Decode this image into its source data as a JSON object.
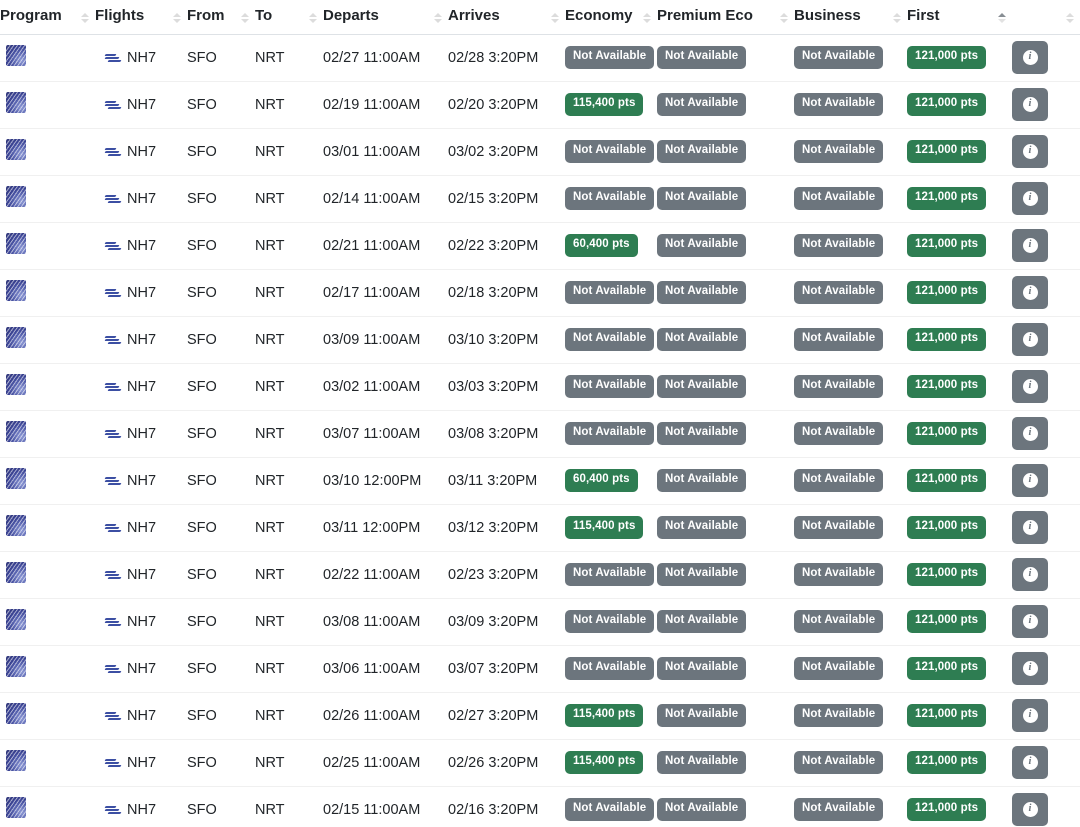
{
  "table": {
    "columns": [
      {
        "key": "program",
        "label": "Program",
        "sortable": true,
        "sort_state": "none"
      },
      {
        "key": "flights",
        "label": "Flights",
        "sortable": true,
        "sort_state": "none"
      },
      {
        "key": "from",
        "label": "From",
        "sortable": true,
        "sort_state": "none"
      },
      {
        "key": "to",
        "label": "To",
        "sortable": true,
        "sort_state": "none"
      },
      {
        "key": "departs",
        "label": "Departs",
        "sortable": true,
        "sort_state": "none"
      },
      {
        "key": "arrives",
        "label": "Arrives",
        "sortable": true,
        "sort_state": "none"
      },
      {
        "key": "economy",
        "label": "Economy",
        "sortable": true,
        "sort_state": "none"
      },
      {
        "key": "premium",
        "label": "Premium Eco",
        "sortable": true,
        "sort_state": "none"
      },
      {
        "key": "business",
        "label": "Business",
        "sortable": true,
        "sort_state": "none"
      },
      {
        "key": "first",
        "label": "First",
        "sortable": true,
        "sort_state": "asc"
      },
      {
        "key": "info",
        "label": "",
        "sortable": true,
        "sort_state": "none"
      }
    ],
    "not_available_label": "Not Available",
    "info_icon": "info-icon",
    "program_icon": "ana-program-logo-icon",
    "airline_icon": "ana-airline-logo-icon",
    "colors": {
      "badge_available": "#2e7d52",
      "badge_unavailable": "#6c757d",
      "text": "#212529",
      "header_divider": "#dee2e6",
      "program_logo": "#3b4495"
    },
    "rows": [
      {
        "flight": "NH7",
        "from": "SFO",
        "to": "NRT",
        "departs": "02/27 11:00AM",
        "arrives": "02/28 3:20PM",
        "economy": "Not Available",
        "economy_available": false,
        "premium": "Not Available",
        "premium_available": false,
        "business": "Not Available",
        "business_available": false,
        "first": "121,000 pts",
        "first_available": true
      },
      {
        "flight": "NH7",
        "from": "SFO",
        "to": "NRT",
        "departs": "02/19 11:00AM",
        "arrives": "02/20 3:20PM",
        "economy": "115,400 pts",
        "economy_available": true,
        "premium": "Not Available",
        "premium_available": false,
        "business": "Not Available",
        "business_available": false,
        "first": "121,000 pts",
        "first_available": true
      },
      {
        "flight": "NH7",
        "from": "SFO",
        "to": "NRT",
        "departs": "03/01 11:00AM",
        "arrives": "03/02 3:20PM",
        "economy": "Not Available",
        "economy_available": false,
        "premium": "Not Available",
        "premium_available": false,
        "business": "Not Available",
        "business_available": false,
        "first": "121,000 pts",
        "first_available": true
      },
      {
        "flight": "NH7",
        "from": "SFO",
        "to": "NRT",
        "departs": "02/14 11:00AM",
        "arrives": "02/15 3:20PM",
        "economy": "Not Available",
        "economy_available": false,
        "premium": "Not Available",
        "premium_available": false,
        "business": "Not Available",
        "business_available": false,
        "first": "121,000 pts",
        "first_available": true
      },
      {
        "flight": "NH7",
        "from": "SFO",
        "to": "NRT",
        "departs": "02/21 11:00AM",
        "arrives": "02/22 3:20PM",
        "economy": "60,400 pts",
        "economy_available": true,
        "premium": "Not Available",
        "premium_available": false,
        "business": "Not Available",
        "business_available": false,
        "first": "121,000 pts",
        "first_available": true
      },
      {
        "flight": "NH7",
        "from": "SFO",
        "to": "NRT",
        "departs": "02/17 11:00AM",
        "arrives": "02/18 3:20PM",
        "economy": "Not Available",
        "economy_available": false,
        "premium": "Not Available",
        "premium_available": false,
        "business": "Not Available",
        "business_available": false,
        "first": "121,000 pts",
        "first_available": true
      },
      {
        "flight": "NH7",
        "from": "SFO",
        "to": "NRT",
        "departs": "03/09 11:00AM",
        "arrives": "03/10 3:20PM",
        "economy": "Not Available",
        "economy_available": false,
        "premium": "Not Available",
        "premium_available": false,
        "business": "Not Available",
        "business_available": false,
        "first": "121,000 pts",
        "first_available": true
      },
      {
        "flight": "NH7",
        "from": "SFO",
        "to": "NRT",
        "departs": "03/02 11:00AM",
        "arrives": "03/03 3:20PM",
        "economy": "Not Available",
        "economy_available": false,
        "premium": "Not Available",
        "premium_available": false,
        "business": "Not Available",
        "business_available": false,
        "first": "121,000 pts",
        "first_available": true
      },
      {
        "flight": "NH7",
        "from": "SFO",
        "to": "NRT",
        "departs": "03/07 11:00AM",
        "arrives": "03/08 3:20PM",
        "economy": "Not Available",
        "economy_available": false,
        "premium": "Not Available",
        "premium_available": false,
        "business": "Not Available",
        "business_available": false,
        "first": "121,000 pts",
        "first_available": true
      },
      {
        "flight": "NH7",
        "from": "SFO",
        "to": "NRT",
        "departs": "03/10 12:00PM",
        "arrives": "03/11 3:20PM",
        "economy": "60,400 pts",
        "economy_available": true,
        "premium": "Not Available",
        "premium_available": false,
        "business": "Not Available",
        "business_available": false,
        "first": "121,000 pts",
        "first_available": true
      },
      {
        "flight": "NH7",
        "from": "SFO",
        "to": "NRT",
        "departs": "03/11 12:00PM",
        "arrives": "03/12 3:20PM",
        "economy": "115,400 pts",
        "economy_available": true,
        "premium": "Not Available",
        "premium_available": false,
        "business": "Not Available",
        "business_available": false,
        "first": "121,000 pts",
        "first_available": true
      },
      {
        "flight": "NH7",
        "from": "SFO",
        "to": "NRT",
        "departs": "02/22 11:00AM",
        "arrives": "02/23 3:20PM",
        "economy": "Not Available",
        "economy_available": false,
        "premium": "Not Available",
        "premium_available": false,
        "business": "Not Available",
        "business_available": false,
        "first": "121,000 pts",
        "first_available": true
      },
      {
        "flight": "NH7",
        "from": "SFO",
        "to": "NRT",
        "departs": "03/08 11:00AM",
        "arrives": "03/09 3:20PM",
        "economy": "Not Available",
        "economy_available": false,
        "premium": "Not Available",
        "premium_available": false,
        "business": "Not Available",
        "business_available": false,
        "first": "121,000 pts",
        "first_available": true
      },
      {
        "flight": "NH7",
        "from": "SFO",
        "to": "NRT",
        "departs": "03/06 11:00AM",
        "arrives": "03/07 3:20PM",
        "economy": "Not Available",
        "economy_available": false,
        "premium": "Not Available",
        "premium_available": false,
        "business": "Not Available",
        "business_available": false,
        "first": "121,000 pts",
        "first_available": true
      },
      {
        "flight": "NH7",
        "from": "SFO",
        "to": "NRT",
        "departs": "02/26 11:00AM",
        "arrives": "02/27 3:20PM",
        "economy": "115,400 pts",
        "economy_available": true,
        "premium": "Not Available",
        "premium_available": false,
        "business": "Not Available",
        "business_available": false,
        "first": "121,000 pts",
        "first_available": true
      },
      {
        "flight": "NH7",
        "from": "SFO",
        "to": "NRT",
        "departs": "02/25 11:00AM",
        "arrives": "02/26 3:20PM",
        "economy": "115,400 pts",
        "economy_available": true,
        "premium": "Not Available",
        "premium_available": false,
        "business": "Not Available",
        "business_available": false,
        "first": "121,000 pts",
        "first_available": true
      },
      {
        "flight": "NH7",
        "from": "SFO",
        "to": "NRT",
        "departs": "02/15 11:00AM",
        "arrives": "02/16 3:20PM",
        "economy": "Not Available",
        "economy_available": false,
        "premium": "Not Available",
        "premium_available": false,
        "business": "Not Available",
        "business_available": false,
        "first": "121,000 pts",
        "first_available": true
      }
    ]
  }
}
